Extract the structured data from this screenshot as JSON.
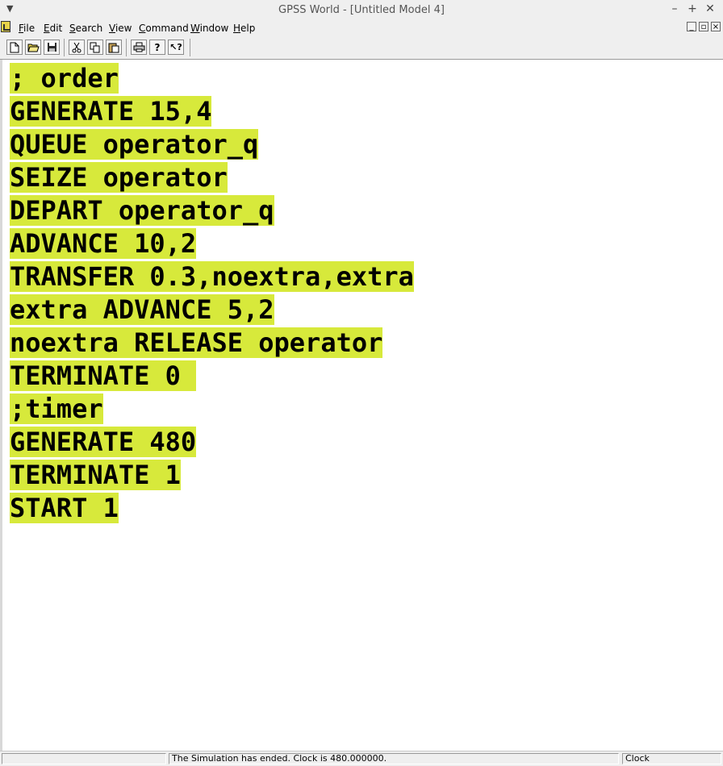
{
  "window": {
    "title": "GPSS World - [Untitled Model 4]",
    "controls": {
      "minimize": "–",
      "maximize": "+",
      "close": "✕"
    }
  },
  "menubar": {
    "items": [
      "File",
      "Edit",
      "Search",
      "View",
      "Command",
      "Window",
      "Help"
    ]
  },
  "toolbar": {
    "buttons": [
      "new-document-icon",
      "open-folder-icon",
      "save-icon",
      "cut-icon",
      "copy-icon",
      "paste-icon",
      "print-icon",
      "help-icon",
      "context-help-icon"
    ]
  },
  "editor": {
    "highlight_color": "#d7e93b",
    "lines": [
      "; order",
      "GENERATE 15,4",
      "QUEUE operator_q",
      "SEIZE operator",
      "DEPART operator_q",
      "ADVANCE 10,2",
      "TRANSFER 0.3,noextra,extra",
      "extra ADVANCE 5,2",
      "noextra RELEASE operator",
      "TERMINATE 0 ",
      ";timer",
      "GENERATE 480",
      "TERMINATE 1",
      "START 1"
    ]
  },
  "statusbar": {
    "message": "The Simulation has ended.  Clock is 480.000000.",
    "clock_label": "Clock"
  }
}
